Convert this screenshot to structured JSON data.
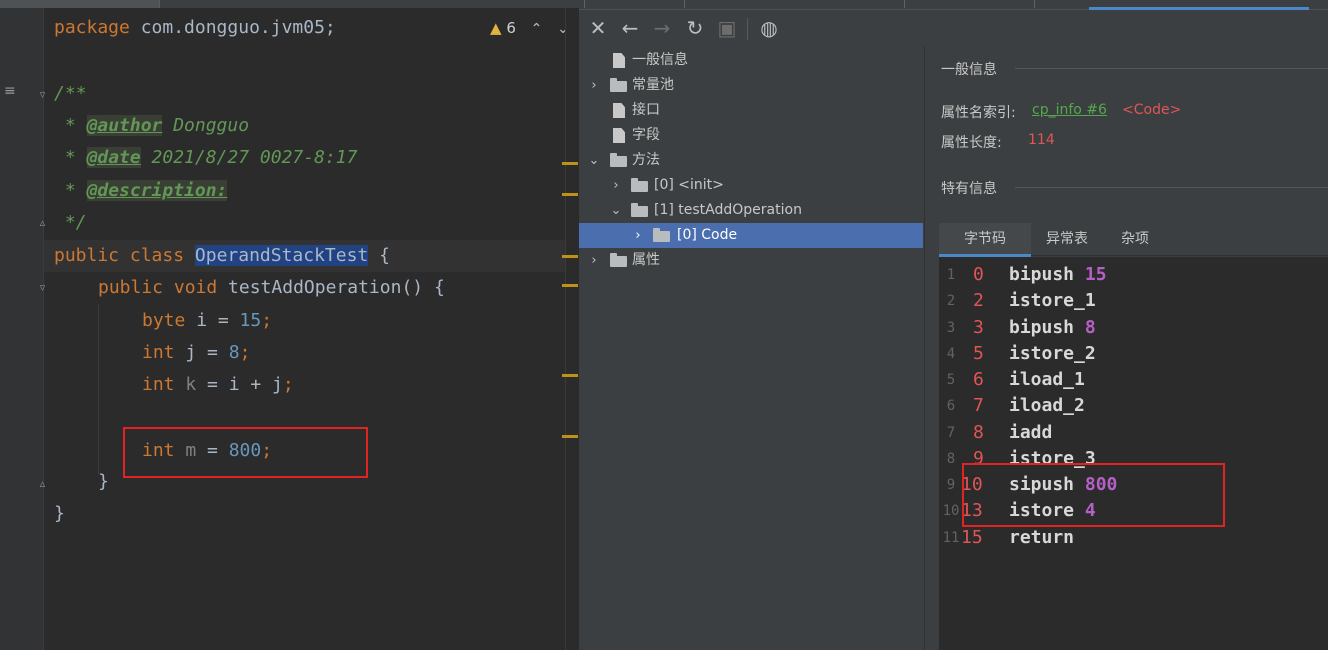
{
  "editor": {
    "warning_count": "6",
    "code_lines": {
      "l1": {
        "kw": "package",
        "rest": " com.dongguo.jvm05;"
      },
      "l3": {
        "text": "/**"
      },
      "l4": {
        "prefix": " * ",
        "tag": "@author",
        "value": " Dongguo"
      },
      "l5": {
        "prefix": " * ",
        "tag": "@date",
        "value": " 2021/8/27 0027-8:17"
      },
      "l6": {
        "prefix": " * ",
        "tag": "@description:"
      },
      "l7": {
        "text": " */"
      },
      "l8": {
        "kw": "public class ",
        "cls": "OperandStackTest",
        "rest": " {"
      },
      "l9": {
        "kw": "public void ",
        "name": "testAddOperation",
        "rest": "() {"
      },
      "l10": {
        "kw": "byte ",
        "var": "i = ",
        "num": "15",
        "end": ";"
      },
      "l11": {
        "kw": "int ",
        "var": "j = ",
        "num": "8",
        "end": ";"
      },
      "l12": {
        "kw": "int ",
        "unused": "k",
        "var": " = i + j",
        "end": ";"
      },
      "l14": {
        "kw": "int ",
        "unused": "m",
        "var": " = ",
        "num": "800",
        "end": ";"
      },
      "l15": {
        "text": "}"
      },
      "l16": {
        "text": "}"
      }
    }
  },
  "tree": {
    "items": [
      {
        "label": "一般信息"
      },
      {
        "label": "常量池"
      },
      {
        "label": "接口"
      },
      {
        "label": "字段"
      },
      {
        "label": "方法"
      },
      {
        "label": "[0] <init>"
      },
      {
        "label": "[1] testAddOperation"
      },
      {
        "label": "[0] Code"
      },
      {
        "label": "属性"
      }
    ]
  },
  "details": {
    "general_title": "一般信息",
    "name_index_label": "属性名索引:",
    "name_index_link": "cp_info #6",
    "name_index_value": "<Code>",
    "length_label": "属性长度:",
    "length_value": "114",
    "specific_title": "特有信息",
    "tabs": [
      "字节码",
      "异常表",
      "杂项"
    ]
  },
  "bytecode": [
    {
      "ln": "1",
      "off": "0",
      "op": "bipush",
      "arg": "15"
    },
    {
      "ln": "2",
      "off": "2",
      "op": "istore_1",
      "arg": ""
    },
    {
      "ln": "3",
      "off": "3",
      "op": "bipush",
      "arg": "8"
    },
    {
      "ln": "4",
      "off": "5",
      "op": "istore_2",
      "arg": ""
    },
    {
      "ln": "5",
      "off": "6",
      "op": "iload_1",
      "arg": ""
    },
    {
      "ln": "6",
      "off": "7",
      "op": "iload_2",
      "arg": ""
    },
    {
      "ln": "7",
      "off": "8",
      "op": "iadd",
      "arg": ""
    },
    {
      "ln": "8",
      "off": "9",
      "op": "istore_3",
      "arg": ""
    },
    {
      "ln": "9",
      "off": "10",
      "op": "sipush",
      "arg": "800"
    },
    {
      "ln": "10",
      "off": "13",
      "op": "istore",
      "arg": "4"
    },
    {
      "ln": "11",
      "off": "15",
      "op": "return",
      "arg": ""
    }
  ],
  "colors": {
    "keyword": "#cc7832",
    "number": "#6897bb",
    "doc_comment": "#629755",
    "class_highlight": "#214283",
    "tree_selected": "#4b6eaf",
    "bytecode_offset": "#e05555",
    "bytecode_arg": "#b65fc7",
    "annotation_box": "#e02424"
  }
}
